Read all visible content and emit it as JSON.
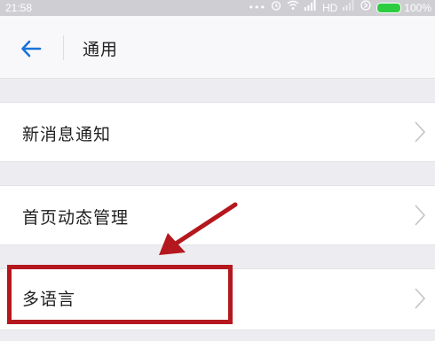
{
  "status_bar": {
    "time": "21:58",
    "network": "HD",
    "battery": "100%",
    "icons": [
      "more-dots-icon",
      "alarm-icon",
      "wifi-icon",
      "signal-icon",
      "signal-icon",
      "nfc-icon",
      "battery-icon"
    ]
  },
  "header": {
    "title": "通用",
    "back_icon": "back-arrow-icon"
  },
  "settings": {
    "items": [
      {
        "label": "新消息通知"
      },
      {
        "label": "首页动态管理"
      },
      {
        "label": "多语言"
      }
    ]
  },
  "annotation": {
    "color": "#b4181e",
    "highlighted_item": "多语言"
  },
  "colors": {
    "accent": "#1a73d9",
    "background": "#f3f3f5",
    "row_background": "#ffffff"
  }
}
